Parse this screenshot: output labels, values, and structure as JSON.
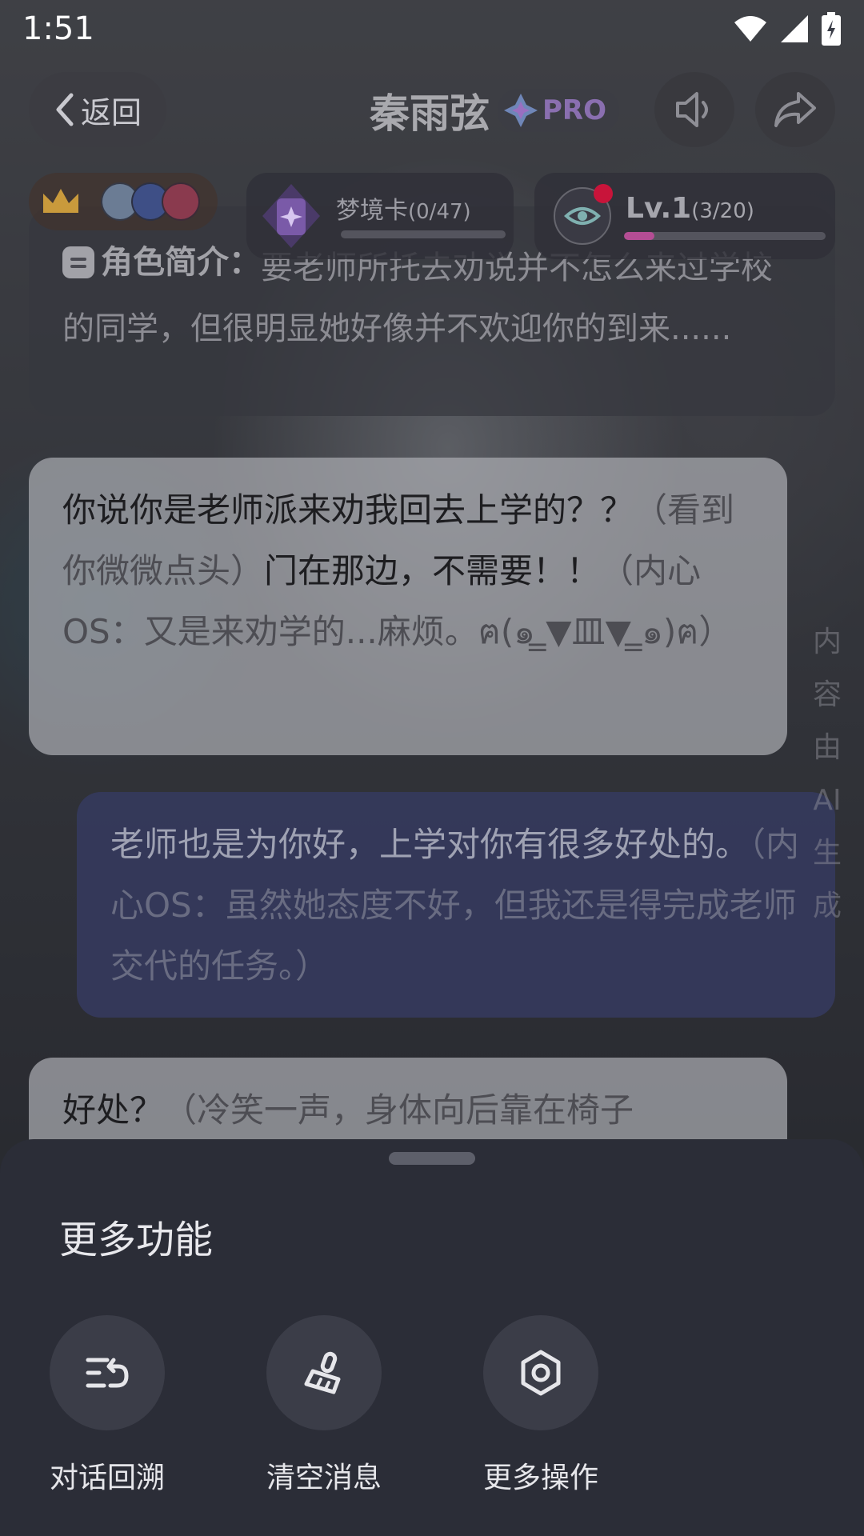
{
  "status_bar": {
    "time": "1:51"
  },
  "header": {
    "back_label": "返回",
    "title": "秦雨弦",
    "pro_badge": "PRO"
  },
  "dream_card": {
    "label": "梦境卡",
    "count": "(0/47)"
  },
  "level": {
    "label": "Lv.1",
    "count": "(3/20)",
    "progress": 0.15,
    "fill_color": "#b44d94"
  },
  "intro": {
    "heading": "角色简介：",
    "text": "要老师所托去劝说并不怎么来过学校的同学，但很明显她好像并不欢迎你的到来......"
  },
  "messages": [
    {
      "role": "npc",
      "parts": [
        {
          "type": "speech",
          "text": "你说你是老师派来劝我回去上学的？？"
        },
        {
          "type": "aside",
          "text": "（看到你微微点头）"
        },
        {
          "type": "speech",
          "text": "门在那边，不需要！！"
        },
        {
          "type": "aside",
          "text": "（内心OS：又是来劝学的...麻烦。ฅ(๑ ̳▼皿▼ ̳๑)ฅ）"
        }
      ]
    },
    {
      "role": "user",
      "parts": [
        {
          "type": "speech",
          "text": "老师也是为你好，上学对你有很多好处的。"
        },
        {
          "type": "aside",
          "text": "（内心OS：虽然她态度不好，但我还是得完成老师交代的任务。）"
        }
      ]
    },
    {
      "role": "npc",
      "parts": [
        {
          "type": "speech",
          "text": "好处？"
        },
        {
          "type": "aside",
          "text": "（冷笑一声，身体向后靠在椅子"
        }
      ]
    }
  ],
  "ai_note": "内容由AI生成",
  "sheet": {
    "title": "更多功能",
    "actions": [
      {
        "label": "对话回溯",
        "icon": "rewind-list-icon"
      },
      {
        "label": "清空消息",
        "icon": "broom-icon"
      },
      {
        "label": "更多操作",
        "icon": "settings-hexagon-icon"
      }
    ]
  }
}
